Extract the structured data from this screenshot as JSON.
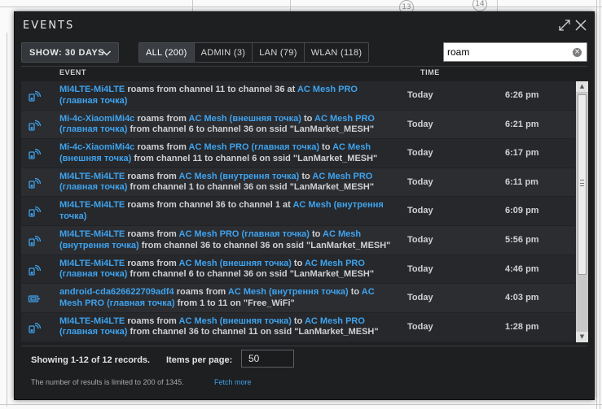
{
  "window": {
    "title": "EVENTS",
    "expand_icon": "expand-arrows-icon",
    "close_icon": "close-icon"
  },
  "toolbar": {
    "show_label": "SHOW: 30 DAYS",
    "tabs": [
      {
        "label": "ALL (200)",
        "active": true
      },
      {
        "label": "ADMIN (3)",
        "active": false
      },
      {
        "label": "LAN (79)",
        "active": false
      },
      {
        "label": "WLAN (118)",
        "active": false
      }
    ],
    "search_value": "roam"
  },
  "table": {
    "col_event": "EVENT",
    "col_time": "TIME",
    "rows": [
      {
        "icon": "wifi-client-icon",
        "parts": [
          {
            "t": "MI4LTE-Mi4LTE",
            "link": true
          },
          {
            "t": " roams from channel 11 to channel 36 at ",
            "link": false
          },
          {
            "t": "AC Mesh PRO (главная точка)",
            "link": true
          }
        ],
        "day": "Today",
        "time": "6:26 pm"
      },
      {
        "icon": "wifi-client-icon",
        "parts": [
          {
            "t": "Mi-4c-XiaomiMi4c",
            "link": true
          },
          {
            "t": " roams from ",
            "link": false
          },
          {
            "t": "AC Mesh (внешняя точка)",
            "link": true
          },
          {
            "t": " to ",
            "link": false
          },
          {
            "t": "AC Mesh PRO (главная точка)",
            "link": true
          },
          {
            "t": " from channel 6 to channel 36 on ssid \"LanMarket_MESH\"",
            "link": false
          }
        ],
        "day": "Today",
        "time": "6:21 pm"
      },
      {
        "icon": "wifi-client-icon",
        "parts": [
          {
            "t": "Mi-4c-XiaomiMi4c",
            "link": true
          },
          {
            "t": " roams from ",
            "link": false
          },
          {
            "t": "AC Mesh PRO (главная точка)",
            "link": true
          },
          {
            "t": " to ",
            "link": false
          },
          {
            "t": "AC Mesh (внешняя точка)",
            "link": true
          },
          {
            "t": " from channel 11 to channel 6 on ssid \"LanMarket_MESH\"",
            "link": false
          }
        ],
        "day": "Today",
        "time": "6:17 pm"
      },
      {
        "icon": "wifi-client-icon",
        "parts": [
          {
            "t": "MI4LTE-Mi4LTE",
            "link": true
          },
          {
            "t": " roams from ",
            "link": false
          },
          {
            "t": "AC Mesh (внутрення точка)",
            "link": true
          },
          {
            "t": " to ",
            "link": false
          },
          {
            "t": "AC Mesh PRO (главная точка)",
            "link": true
          },
          {
            "t": " from channel 1 to channel 36 on ssid \"LanMarket_MESH\"",
            "link": false
          }
        ],
        "day": "Today",
        "time": "6:11 pm"
      },
      {
        "icon": "wifi-client-icon",
        "parts": [
          {
            "t": "MI4LTE-Mi4LTE",
            "link": true
          },
          {
            "t": " roams from channel 36 to channel 1 at ",
            "link": false
          },
          {
            "t": "AC Mesh (внутрення точка)",
            "link": true
          }
        ],
        "day": "Today",
        "time": "6:09 pm"
      },
      {
        "icon": "wifi-client-icon",
        "parts": [
          {
            "t": "MI4LTE-Mi4LTE",
            "link": true
          },
          {
            "t": " roams from ",
            "link": false
          },
          {
            "t": "AC Mesh PRO (главная точка)",
            "link": true
          },
          {
            "t": " to ",
            "link": false
          },
          {
            "t": "AC Mesh (внутрення точка)",
            "link": true
          },
          {
            "t": " from channel 36 to channel 36 on ssid \"LanMarket_MESH\"",
            "link": false
          }
        ],
        "day": "Today",
        "time": "5:56 pm"
      },
      {
        "icon": "wifi-client-icon",
        "parts": [
          {
            "t": "MI4LTE-Mi4LTE",
            "link": true
          },
          {
            "t": " roams from ",
            "link": false
          },
          {
            "t": "AC Mesh (внешняя точка)",
            "link": true
          },
          {
            "t": " to ",
            "link": false
          },
          {
            "t": "AC Mesh PRO (главная точка)",
            "link": true
          },
          {
            "t": " from channel 6 to channel 36 on ssid \"LanMarket_MESH\"",
            "link": false
          }
        ],
        "day": "Today",
        "time": "4:46 pm"
      },
      {
        "icon": "wired-device-icon",
        "parts": [
          {
            "t": "android-cda626622709adf4",
            "link": true
          },
          {
            "t": " roams from ",
            "link": false
          },
          {
            "t": "AC Mesh (внутрення точка)",
            "link": true
          },
          {
            "t": " to ",
            "link": false
          },
          {
            "t": "AC Mesh PRO (главная точка)",
            "link": true
          },
          {
            "t": " from 1 to 11 on \"Free_WiFi\"",
            "link": false
          }
        ],
        "day": "Today",
        "time": "4:03 pm"
      },
      {
        "icon": "wifi-client-icon",
        "parts": [
          {
            "t": "MI4LTE-Mi4LTE",
            "link": true
          },
          {
            "t": " roams from ",
            "link": false
          },
          {
            "t": "AC Mesh (внешняя точка)",
            "link": true
          },
          {
            "t": " to ",
            "link": false
          },
          {
            "t": "AC Mesh PRO (главная точка)",
            "link": true
          },
          {
            "t": " from channel 36 to channel 11 on ssid \"LanMarket_MESH\"",
            "link": false
          }
        ],
        "day": "Today",
        "time": "1:28 pm"
      }
    ]
  },
  "footer": {
    "showing": "Showing 1-12 of 12 records.",
    "items_per_page_label": "Items per page:",
    "items_per_page_value": "50",
    "limit_text": "The number of results is limited to 200 of 1345.",
    "fetch_more": "Fetch more"
  },
  "background": {
    "marker_a": "13",
    "marker_b": "14"
  },
  "colors": {
    "panel": "#1e1f21",
    "link": "#3fa3ee",
    "text": "#cfd1d4"
  }
}
